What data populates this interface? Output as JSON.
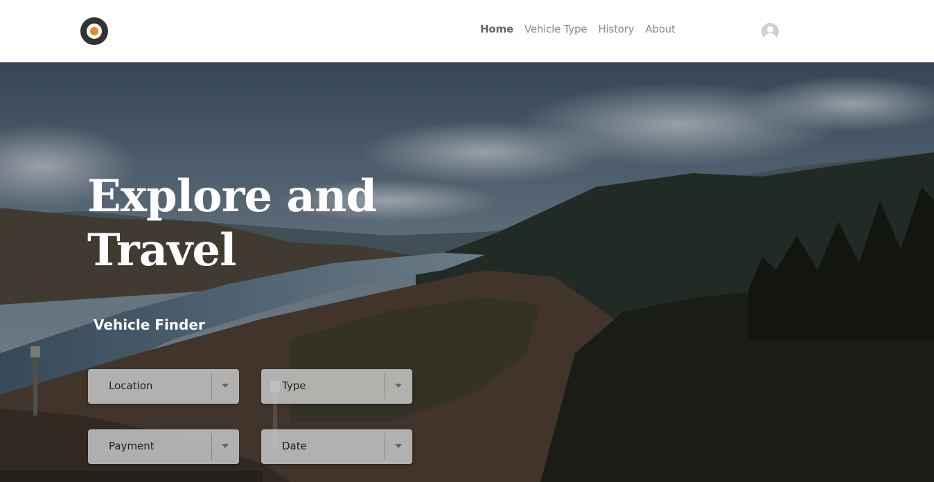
{
  "nav": {
    "items": [
      "Home",
      "Vehicle Type",
      "History",
      "About"
    ],
    "active_index": 0
  },
  "hero": {
    "headline_line1": "Explore and",
    "headline_line2": "Travel",
    "finder_title": "Vehicle Finder"
  },
  "filters": {
    "location": "Location",
    "type": "Type",
    "payment": "Payment",
    "date": "Date"
  },
  "colors": {
    "logo_accent": "#e48a1f",
    "logo_ring": "#333333"
  },
  "icons": {
    "logo": "logo-icon",
    "user": "user-avatar-icon",
    "dropdown": "chevron-down-icon"
  }
}
